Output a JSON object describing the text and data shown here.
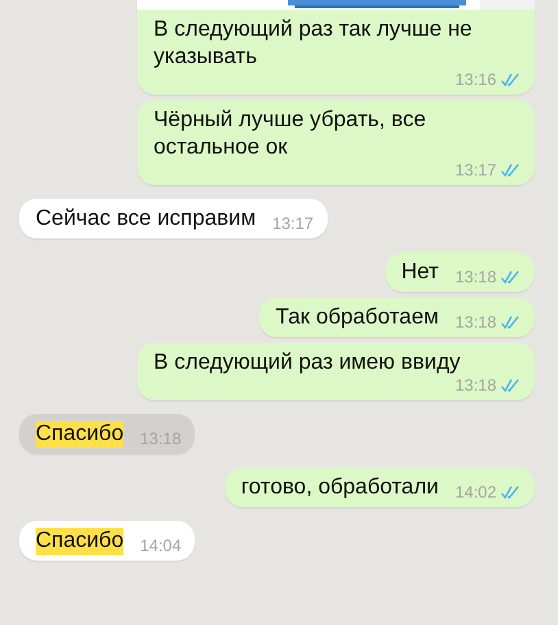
{
  "messages": [
    {
      "kind": "outgoing",
      "attachment": true,
      "text": "В следующий раз так лучше не указывать",
      "time": "13:16",
      "read": true,
      "selected": false,
      "highlight": false
    },
    {
      "kind": "outgoing",
      "attachment": false,
      "text": "Чёрный лучше убрать, все остальное ок",
      "time": "13:17",
      "read": true,
      "selected": false,
      "highlight": false
    },
    {
      "kind": "incoming",
      "attachment": false,
      "text": "Сейчас все исправим",
      "time": "13:17",
      "selected": false,
      "highlight": false
    },
    {
      "kind": "outgoing",
      "attachment": false,
      "text": "Нет",
      "time": "13:18",
      "read": true,
      "selected": false,
      "highlight": false
    },
    {
      "kind": "outgoing",
      "attachment": false,
      "text": "Так обработаем",
      "time": "13:18",
      "read": true,
      "selected": false,
      "highlight": false
    },
    {
      "kind": "outgoing",
      "attachment": false,
      "text": "В следующий раз имею ввиду",
      "time": "13:18",
      "read": true,
      "selected": false,
      "highlight": false
    },
    {
      "kind": "incoming",
      "attachment": false,
      "text": "Спасибо",
      "time": "13:18",
      "selected": true,
      "highlight": true
    },
    {
      "kind": "outgoing",
      "attachment": false,
      "text": "готово, обработали",
      "time": "14:02",
      "read": true,
      "selected": false,
      "highlight": false
    },
    {
      "kind": "incoming",
      "attachment": false,
      "text": "Спасибо",
      "time": "14:04",
      "selected": false,
      "highlight": true
    }
  ]
}
